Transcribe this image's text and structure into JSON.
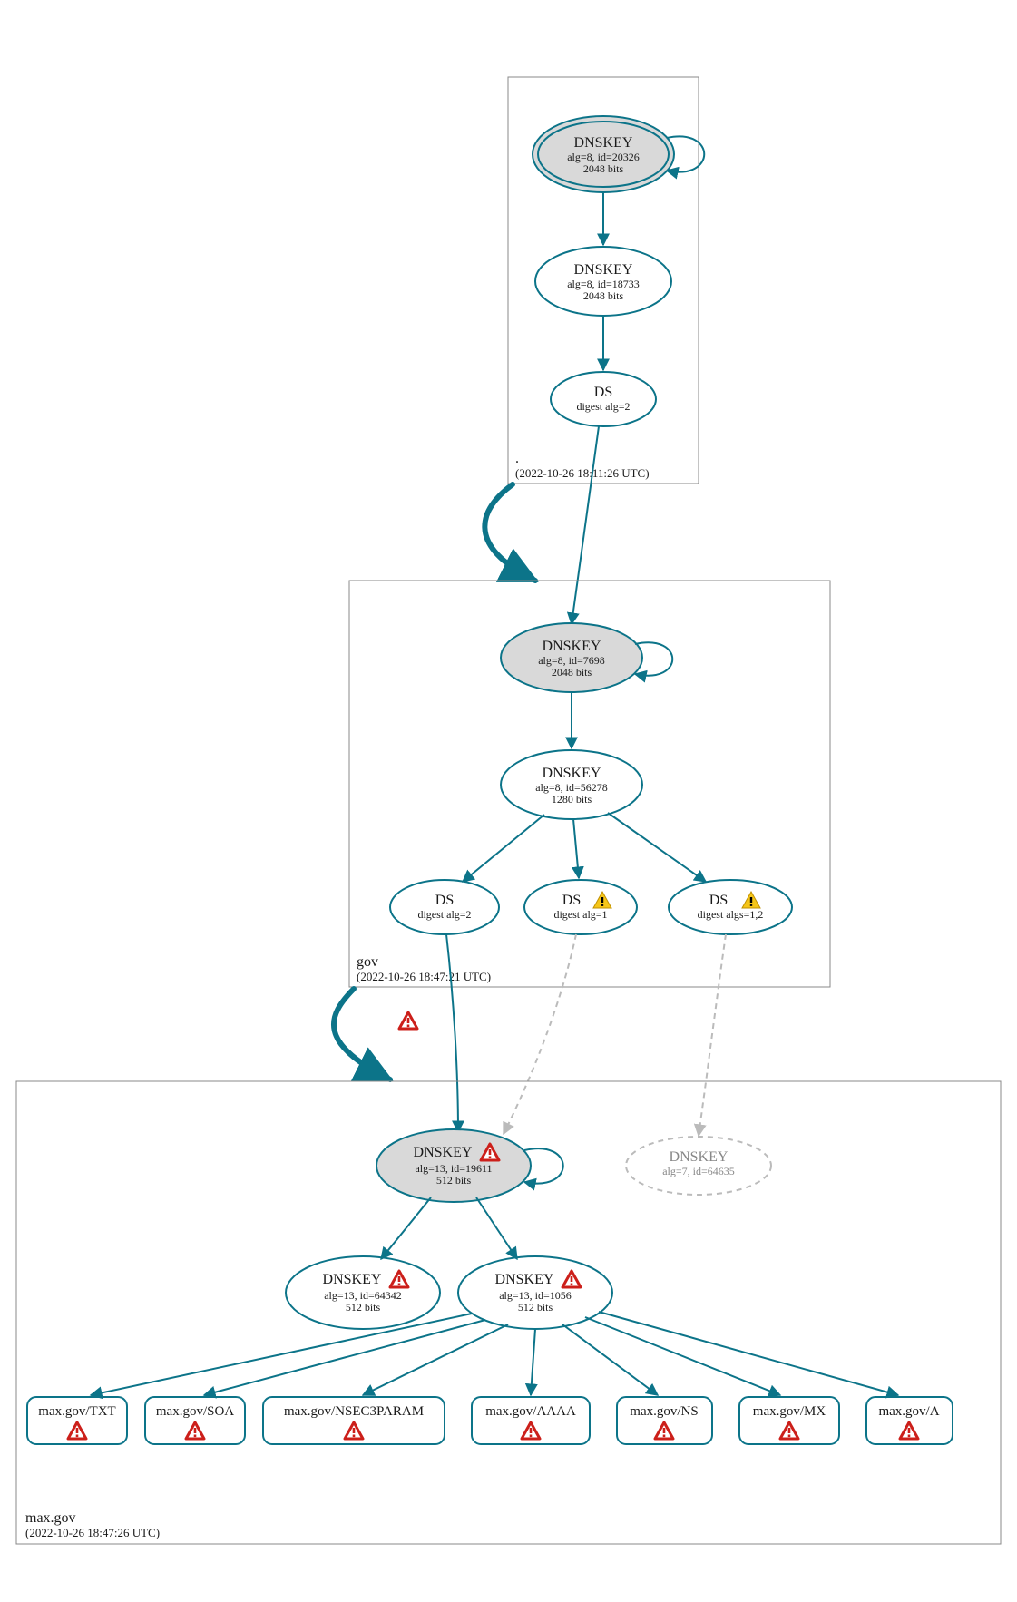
{
  "colors": {
    "stroke": "#0c7489",
    "fill_grey": "#d9d9d9",
    "dashed_grey": "#bbbbbb",
    "warn_red": "#cc1f1a",
    "warn_yellow": "#f5c518"
  },
  "zones": {
    "root": {
      "label": ".",
      "timestamp": "(2022-10-26 18:11:26 UTC)"
    },
    "gov": {
      "label": "gov",
      "timestamp": "(2022-10-26 18:47:21 UTC)"
    },
    "maxgov": {
      "label": "max.gov",
      "timestamp": "(2022-10-26 18:47:26 UTC)"
    }
  },
  "nodes": {
    "root_ksk": {
      "title": "DNSKEY",
      "line2": "alg=8, id=20326",
      "line3": "2048 bits"
    },
    "root_zsk": {
      "title": "DNSKEY",
      "line2": "alg=8, id=18733",
      "line3": "2048 bits"
    },
    "root_ds": {
      "title": "DS",
      "line2": "digest alg=2"
    },
    "gov_ksk": {
      "title": "DNSKEY",
      "line2": "alg=8, id=7698",
      "line3": "2048 bits"
    },
    "gov_zsk": {
      "title": "DNSKEY",
      "line2": "alg=8, id=56278",
      "line3": "1280 bits"
    },
    "gov_ds1": {
      "title": "DS",
      "line2": "digest alg=2"
    },
    "gov_ds2": {
      "title": "DS",
      "line2": "digest alg=1"
    },
    "gov_ds3": {
      "title": "DS",
      "line2": "digest algs=1,2"
    },
    "max_ksk": {
      "title": "DNSKEY",
      "line2": "alg=13, id=19611",
      "line3": "512 bits"
    },
    "max_old": {
      "title": "DNSKEY",
      "line2": "alg=7, id=64635"
    },
    "max_zsk1": {
      "title": "DNSKEY",
      "line2": "alg=13, id=64342",
      "line3": "512 bits"
    },
    "max_zsk2": {
      "title": "DNSKEY",
      "line2": "alg=13, id=1056",
      "line3": "512 bits"
    }
  },
  "records": {
    "txt": "max.gov/TXT",
    "soa": "max.gov/SOA",
    "nsec": "max.gov/NSEC3PARAM",
    "aaaa": "max.gov/AAAA",
    "ns": "max.gov/NS",
    "mx": "max.gov/MX",
    "a": "max.gov/A"
  }
}
